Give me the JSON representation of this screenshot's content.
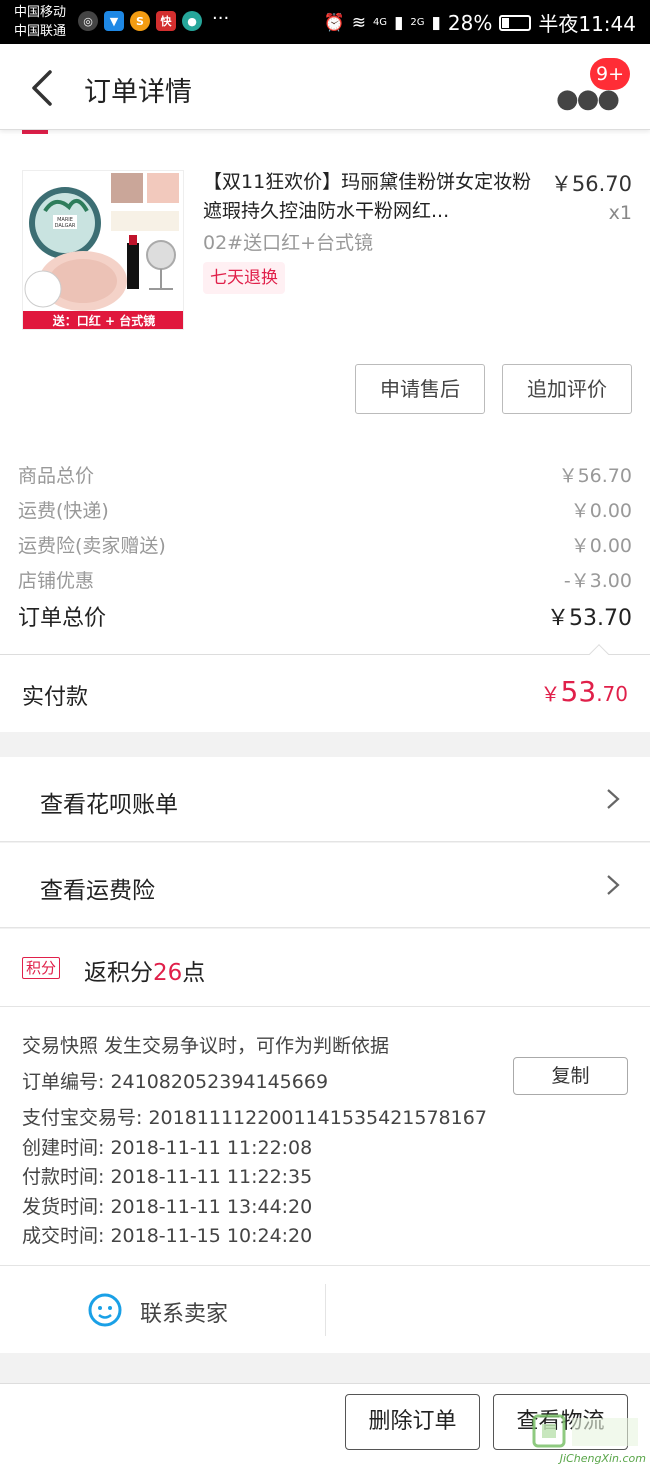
{
  "status_bar": {
    "carrier1": "中国移动",
    "carrier2": "中国联通",
    "signal_4g": "4G",
    "signal_2g": "2G",
    "battery": "28%",
    "time": "半夜11:44"
  },
  "header": {
    "title": "订单详情",
    "badge": "9+"
  },
  "product": {
    "title": "【双11狂欢价】玛丽黛佳粉饼女定妆粉遮瑕持久控油防水干粉网红...",
    "price": "￥56.70",
    "qty": "x1",
    "sku": "02#送口红+台式镜",
    "tag": "七天退换",
    "image_caption": "送：口红 + 台式镜",
    "image_brand": "MARIE DALGAR",
    "after_sale_label": "申请售后",
    "review_label": "追加评价"
  },
  "summary": {
    "rows": [
      {
        "label": "商品总价",
        "value": "￥56.70"
      },
      {
        "label": "运费(快递)",
        "value": "￥0.00"
      },
      {
        "label": "运费险(卖家赠送)",
        "value": "￥0.00"
      },
      {
        "label": "店铺优惠",
        "value": "-￥3.00"
      }
    ],
    "total_label": "订单总价",
    "total_value": "￥53.70"
  },
  "payment": {
    "label": "实付款",
    "currency": "￥",
    "amount_int": "53",
    "amount_dec": ".70"
  },
  "links": {
    "huabei": "查看花呗账单",
    "freight_insurance": "查看运费险"
  },
  "points": {
    "badge": "积分",
    "prefix": "返积分",
    "value": "26",
    "suffix": "点"
  },
  "transaction": {
    "snapshot": "交易快照  发生交易争议时，可作为判断依据",
    "order_no": "订单编号: 241082052394145669",
    "copy_label": "复制",
    "alipay_no": "支付宝交易号: 2018111122001141535421578167",
    "created": "创建时间: 2018-11-11 11:22:08",
    "paid": "付款时间: 2018-11-11 11:22:35",
    "shipped": "发货时间: 2018-11-11 13:44:20",
    "completed": "成交时间: 2018-11-15 10:24:20"
  },
  "contact": {
    "label": "联系卖家"
  },
  "bottom": {
    "delete_label": "删除订单",
    "logistics_label": "查看物流"
  },
  "watermark": {
    "text": "JiChengXin.com"
  },
  "colors": {
    "accent": "#e0204a",
    "badge": "#ff2d36",
    "background": "#f2f2f2"
  }
}
